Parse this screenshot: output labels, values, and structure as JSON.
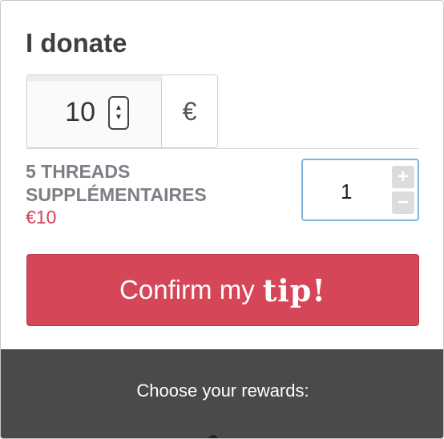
{
  "title": "I donate",
  "amount": {
    "value": "10",
    "currency": "€",
    "spin_up_icon": "chevron-up-icon",
    "spin_down_icon": "chevron-down-icon"
  },
  "reward": {
    "name": "5 THREADS SUPPLÉMENTAIRES",
    "price": "€10",
    "quantity": "1",
    "plus_label": "+",
    "minus_label": "−"
  },
  "confirm": {
    "text": "Confirm my",
    "emphasis": "tip!"
  },
  "footer": {
    "text": "Choose your rewards:"
  },
  "colors": {
    "accent": "#d54658",
    "price": "#d0435a",
    "footer_bg": "#4a4a4a",
    "focus_border": "#7fb3de"
  }
}
